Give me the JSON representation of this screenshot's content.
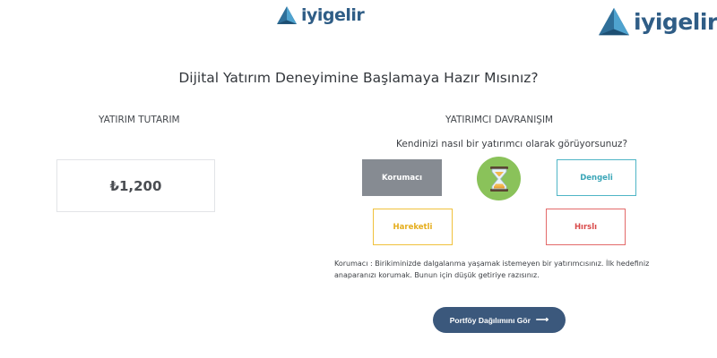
{
  "brand": {
    "name": "iyigelir",
    "primary_color": "#2f5d86",
    "accent_color": "#3ba6b8"
  },
  "headline": "Dijital Yatırım Deneyimine Başlamaya Hazır Mısınız?",
  "investment": {
    "title": "YATIRIM TUTARIM",
    "amount": "₺1,200"
  },
  "behavior": {
    "title": "YATIRIMCI DAVRANIŞIM",
    "question": "Kendinizi nasıl bir yatırımcı olarak görüyorsunuz?",
    "options": [
      {
        "label": "Korumacı",
        "selected": true,
        "color": "#868b92"
      },
      {
        "label": "Dengeli",
        "selected": false,
        "color": "#4fb5c6"
      },
      {
        "label": "Hareketli",
        "selected": false,
        "color": "#f0c13c"
      },
      {
        "label": "Hırslı",
        "selected": false,
        "color": "#e36a6a"
      }
    ],
    "badge_icon": "hourglass-icon",
    "description": "Korumacı : Birikiminizde dalgalanma yaşamak istemeyen bir yatırımcısınız. İlk hedefiniz anaparanızı korumak. Bunun için düşük getiriye razısınız."
  },
  "cta": {
    "label": "Portföy Dağılımını Gör",
    "icon": "arrow-right-icon"
  }
}
